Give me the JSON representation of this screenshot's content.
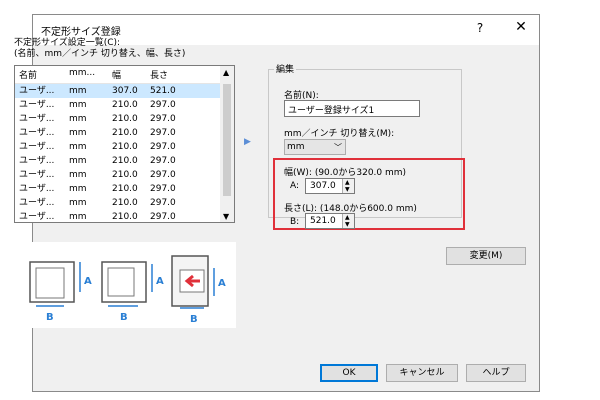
{
  "window": {
    "title": "不定形サイズ登録",
    "help": "?",
    "close": "✕"
  },
  "list": {
    "label_line1": "不定形サイズ設定一覧(C):",
    "label_line2": "(名前、mm／インチ 切り替え、幅、長さ)",
    "headers": [
      "名前",
      "mm...",
      "幅",
      "長さ"
    ],
    "rows": [
      {
        "name": "ユーザ...",
        "unit": "mm",
        "width": "307.0",
        "length": "521.0",
        "selected": true
      },
      {
        "name": "ユーザ...",
        "unit": "mm",
        "width": "210.0",
        "length": "297.0"
      },
      {
        "name": "ユーザ...",
        "unit": "mm",
        "width": "210.0",
        "length": "297.0"
      },
      {
        "name": "ユーザ...",
        "unit": "mm",
        "width": "210.0",
        "length": "297.0"
      },
      {
        "name": "ユーザ...",
        "unit": "mm",
        "width": "210.0",
        "length": "297.0"
      },
      {
        "name": "ユーザ...",
        "unit": "mm",
        "width": "210.0",
        "length": "297.0"
      },
      {
        "name": "ユーザ...",
        "unit": "mm",
        "width": "210.0",
        "length": "297.0"
      },
      {
        "name": "ユーザ...",
        "unit": "mm",
        "width": "210.0",
        "length": "297.0"
      },
      {
        "name": "ユーザ...",
        "unit": "mm",
        "width": "210.0",
        "length": "297.0"
      },
      {
        "name": "ユーザ...",
        "unit": "mm",
        "width": "210.0",
        "length": "297.0"
      }
    ]
  },
  "edit": {
    "legend": "編集",
    "name_label": "名前(N):",
    "name_value": "ユーザー登録サイズ1",
    "unit_label": "mm／インチ 切り替え(M):",
    "unit_value": "mm",
    "width_label": "幅(W): (90.0から320.0 mm)",
    "width_prefix": "A:",
    "width_value": "307.0",
    "length_label": "長さ(L): (148.0から600.0 mm)",
    "length_prefix": "B:",
    "length_value": "521.0",
    "highlight_color": "#e0303a"
  },
  "buttons": {
    "change": "変更(M)",
    "ok": "OK",
    "cancel": "キャンセル",
    "help": "ヘルプ"
  },
  "illustration": {
    "label_a": "A",
    "label_b": "B"
  }
}
